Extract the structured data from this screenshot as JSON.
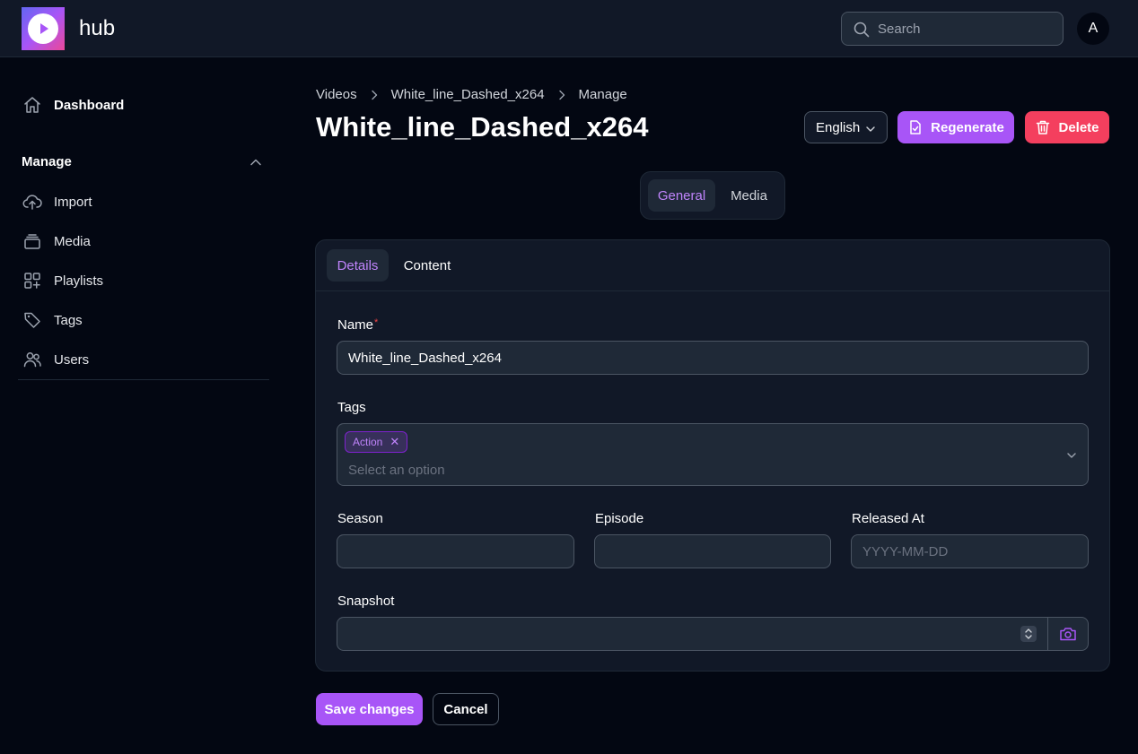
{
  "header": {
    "brand": "hub",
    "search_placeholder": "Search",
    "avatar_initial": "A"
  },
  "sidebar": {
    "dashboard": "Dashboard",
    "group_title": "Manage",
    "items": [
      {
        "label": "Import",
        "icon": "cloud-upload-icon"
      },
      {
        "label": "Media",
        "icon": "stack-icon"
      },
      {
        "label": "Playlists",
        "icon": "squares-plus-icon"
      },
      {
        "label": "Tags",
        "icon": "tag-icon"
      },
      {
        "label": "Users",
        "icon": "users-icon"
      }
    ]
  },
  "breadcrumb": [
    "Videos",
    "White_line_Dashed_x264",
    "Manage"
  ],
  "page": {
    "title": "White_line_Dashed_x264",
    "language": "English",
    "regenerate_label": "Regenerate",
    "delete_label": "Delete"
  },
  "main_tabs": {
    "general": "General",
    "media": "Media",
    "active": "General"
  },
  "card_tabs": {
    "details": "Details",
    "content": "Content",
    "active": "Details"
  },
  "form": {
    "name_label": "Name",
    "name_required_mark": "*",
    "name_value": "White_line_Dashed_x264",
    "tags_label": "Tags",
    "tags": [
      "Action"
    ],
    "tags_placeholder": "Select an option",
    "season_label": "Season",
    "season_value": "",
    "episode_label": "Episode",
    "episode_value": "",
    "released_label": "Released At",
    "released_placeholder": "YYYY-MM-DD",
    "snapshot_label": "Snapshot",
    "snapshot_value": ""
  },
  "actions": {
    "save_label": "Save changes",
    "cancel_label": "Cancel"
  },
  "colors": {
    "accent": "#a855f7",
    "danger": "#f43f5e",
    "background": "#030712",
    "panel": "#111827"
  }
}
